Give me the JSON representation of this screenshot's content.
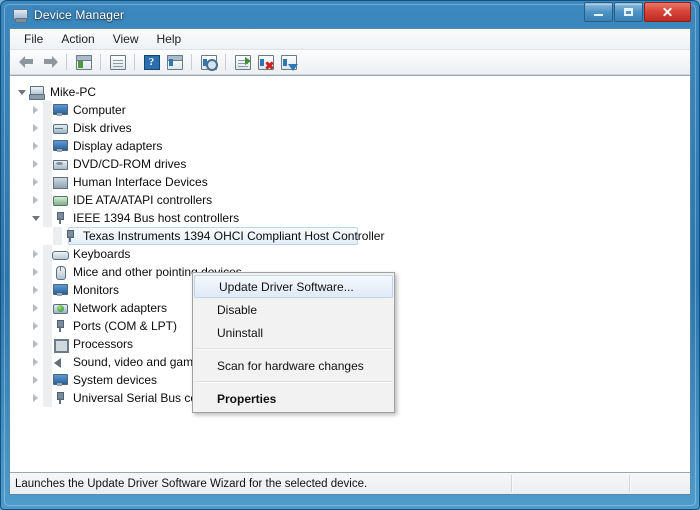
{
  "window": {
    "title": "Device Manager",
    "icon": "device-manager-icon",
    "controls": {
      "minimize": "Minimize",
      "maximize": "Maximize",
      "close": "Close"
    }
  },
  "menubar": {
    "items": [
      {
        "label": "File"
      },
      {
        "label": "Action"
      },
      {
        "label": "View"
      },
      {
        "label": "Help"
      }
    ]
  },
  "toolbar": {
    "buttons": [
      {
        "name": "back-button",
        "icon": "arrow-left-icon",
        "tooltip": "Back"
      },
      {
        "name": "forward-button",
        "icon": "arrow-right-icon",
        "tooltip": "Forward"
      },
      {
        "name": "show-hide-console-tree-button",
        "icon": "console-tree-icon",
        "tooltip": "Show/Hide Console Tree"
      },
      {
        "name": "properties-button",
        "icon": "properties-icon",
        "tooltip": "Properties"
      },
      {
        "name": "help-button",
        "icon": "help-question-icon",
        "tooltip": "Help"
      },
      {
        "name": "view-button",
        "icon": "view-pane-icon",
        "tooltip": "View"
      },
      {
        "name": "scan-hardware-changes-button",
        "icon": "scan-hardware-icon",
        "tooltip": "Scan for hardware changes"
      },
      {
        "name": "update-driver-button",
        "icon": "update-driver-icon",
        "tooltip": "Update Driver Software"
      },
      {
        "name": "uninstall-button",
        "icon": "uninstall-red-x-icon",
        "tooltip": "Uninstall"
      },
      {
        "name": "disable-button",
        "icon": "disable-down-arrow-icon",
        "tooltip": "Disable"
      }
    ]
  },
  "tree": {
    "root": {
      "label": "Mike-PC",
      "icon": "computer-root-icon",
      "expanded": true
    },
    "items": [
      {
        "label": "Computer",
        "icon": "computer-icon",
        "state": "collapsed",
        "level": 1
      },
      {
        "label": "Disk drives",
        "icon": "disk-drive-icon",
        "state": "collapsed",
        "level": 1
      },
      {
        "label": "Display adapters",
        "icon": "display-adapter-icon",
        "state": "collapsed",
        "level": 1
      },
      {
        "label": "DVD/CD-ROM drives",
        "icon": "dvd-drive-icon",
        "state": "collapsed",
        "level": 1
      },
      {
        "label": "Human Interface Devices",
        "icon": "hid-icon",
        "state": "collapsed",
        "level": 1
      },
      {
        "label": "IDE ATA/ATAPI controllers",
        "icon": "ide-controller-icon",
        "state": "collapsed",
        "level": 1
      },
      {
        "label": "IEEE 1394 Bus host controllers",
        "icon": "ieee1394-icon",
        "state": "expanded",
        "level": 1
      },
      {
        "label": "Texas Instruments 1394 OHCI Compliant Host Controller",
        "icon": "ieee1394-device-icon",
        "state": "leaf",
        "level": 2,
        "selected": true
      },
      {
        "label": "Keyboards",
        "icon": "keyboard-icon",
        "state": "collapsed",
        "level": 1
      },
      {
        "label": "Mice and other pointing devices",
        "icon": "mouse-icon",
        "state": "collapsed",
        "level": 1
      },
      {
        "label": "Monitors",
        "icon": "monitor-icon",
        "state": "collapsed",
        "level": 1
      },
      {
        "label": "Network adapters",
        "icon": "network-adapter-icon",
        "state": "collapsed",
        "level": 1
      },
      {
        "label": "Ports (COM & LPT)",
        "icon": "port-icon",
        "state": "collapsed",
        "level": 1
      },
      {
        "label": "Processors",
        "icon": "processor-icon",
        "state": "collapsed",
        "level": 1
      },
      {
        "label": "Sound, video and game controllers",
        "icon": "sound-icon",
        "state": "collapsed",
        "level": 1
      },
      {
        "label": "System devices",
        "icon": "system-device-icon",
        "state": "collapsed",
        "level": 1
      },
      {
        "label": "Universal Serial Bus controllers",
        "icon": "usb-controller-icon",
        "state": "collapsed",
        "level": 1
      }
    ]
  },
  "context_menu": {
    "items": [
      {
        "label": "Update Driver Software...",
        "style": "highlight"
      },
      {
        "label": "Disable",
        "style": "normal"
      },
      {
        "label": "Uninstall",
        "style": "normal"
      },
      {
        "type": "separator"
      },
      {
        "label": "Scan for hardware changes",
        "style": "normal"
      },
      {
        "type": "separator"
      },
      {
        "label": "Properties",
        "style": "bold"
      }
    ]
  },
  "statusbar": {
    "message": "Launches the Update Driver Software Wizard for the selected device."
  },
  "colors": {
    "frame_blue": "#2b76ad",
    "close_red": "#d9453a",
    "selection_blue": "#b8d4ea",
    "menu_bg": "#f2f2f2",
    "tree_bg": "#ffffff"
  }
}
